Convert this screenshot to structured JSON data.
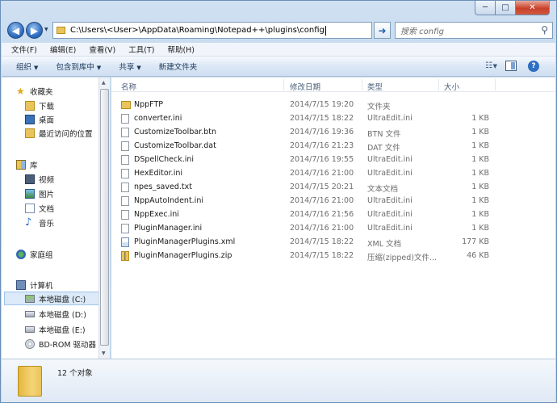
{
  "address": {
    "path": "C:\\Users\\<User>\\AppData\\Roaming\\Notepad++\\plugins\\config"
  },
  "search": {
    "placeholder": "搜索 config"
  },
  "menu": [
    "文件(F)",
    "编辑(E)",
    "查看(V)",
    "工具(T)",
    "帮助(H)"
  ],
  "toolbar": {
    "organize": "组织",
    "include_in_library": "包含到库中",
    "share": "共享",
    "new_folder": "新建文件夹"
  },
  "nav": {
    "favorites": "收藏夹",
    "downloads": "下载",
    "desktop": "桌面",
    "recent": "最近访问的位置",
    "libraries": "库",
    "videos": "视频",
    "pictures": "图片",
    "documents": "文档",
    "music": "音乐",
    "homegroup": "家庭组",
    "computer": "计算机",
    "drive_c": "本地磁盘 (C:)",
    "drive_d": "本地磁盘 (D:)",
    "drive_e": "本地磁盘 (E:)",
    "bdrom": "BD-ROM 驱动器"
  },
  "columns": {
    "name": "名称",
    "modified": "修改日期",
    "type": "类型",
    "size": "大小"
  },
  "files": [
    {
      "name": "NppFTP",
      "modified": "2014/7/15 19:20",
      "type": "文件夹",
      "size": "",
      "icon": "folder"
    },
    {
      "name": "converter.ini",
      "modified": "2014/7/15 18:22",
      "type": "UltraEdit.ini",
      "size": "1 KB",
      "icon": "file"
    },
    {
      "name": "CustomizeToolbar.btn",
      "modified": "2014/7/16 19:36",
      "type": "BTN 文件",
      "size": "1 KB",
      "icon": "file"
    },
    {
      "name": "CustomizeToolbar.dat",
      "modified": "2014/7/16 21:23",
      "type": "DAT 文件",
      "size": "1 KB",
      "icon": "file"
    },
    {
      "name": "DSpellCheck.ini",
      "modified": "2014/7/16 19:55",
      "type": "UltraEdit.ini",
      "size": "1 KB",
      "icon": "file"
    },
    {
      "name": "HexEditor.ini",
      "modified": "2014/7/16 21:00",
      "type": "UltraEdit.ini",
      "size": "1 KB",
      "icon": "file"
    },
    {
      "name": "npes_saved.txt",
      "modified": "2014/7/15 20:21",
      "type": "文本文档",
      "size": "1 KB",
      "icon": "file"
    },
    {
      "name": "NppAutoIndent.ini",
      "modified": "2014/7/16 21:00",
      "type": "UltraEdit.ini",
      "size": "1 KB",
      "icon": "file"
    },
    {
      "name": "NppExec.ini",
      "modified": "2014/7/16 21:56",
      "type": "UltraEdit.ini",
      "size": "1 KB",
      "icon": "file"
    },
    {
      "name": "PluginManager.ini",
      "modified": "2014/7/16 21:00",
      "type": "UltraEdit.ini",
      "size": "1 KB",
      "icon": "file"
    },
    {
      "name": "PluginManagerPlugins.xml",
      "modified": "2014/7/15 18:22",
      "type": "XML 文档",
      "size": "177 KB",
      "icon": "xml"
    },
    {
      "name": "PluginManagerPlugins.zip",
      "modified": "2014/7/15 18:22",
      "type": "压缩(zipped)文件...",
      "size": "46 KB",
      "icon": "zip"
    }
  ],
  "status": {
    "count": "12 个对象"
  }
}
